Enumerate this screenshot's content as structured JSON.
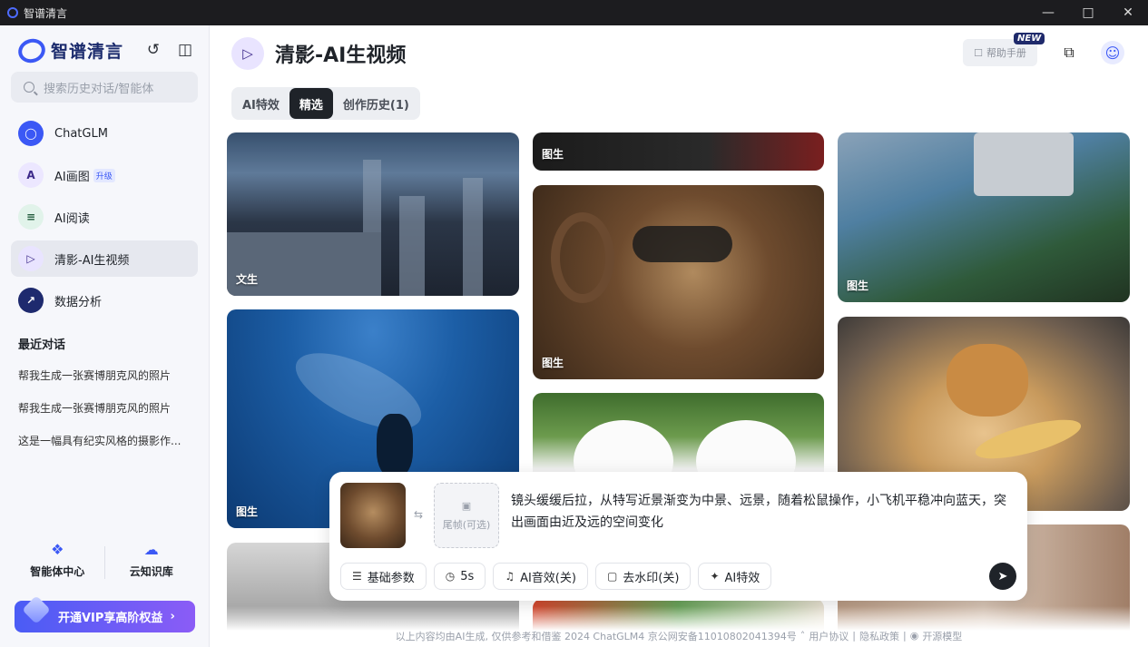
{
  "window": {
    "title": "智谱清言"
  },
  "sidebar": {
    "brand": "智谱清言",
    "search_placeholder": "搜索历史对话/智能体",
    "nav": [
      {
        "label": "ChatGLM",
        "icon": "chatglm-icon"
      },
      {
        "label": "AI画图",
        "icon": "ai-draw-icon",
        "badge": "升级"
      },
      {
        "label": "AI阅读",
        "icon": "ai-read-icon"
      },
      {
        "label": "清影-AI生视频",
        "icon": "video-play-icon"
      },
      {
        "label": "数据分析",
        "icon": "data-chart-icon"
      }
    ],
    "recent_title": "最近对话",
    "recent": [
      "帮我生成一张赛博朋克风的照片",
      "帮我生成一张赛博朋克风的照片",
      "这是一幅具有纪实风格的摄影作..."
    ],
    "bottom": [
      {
        "label": "智能体中心",
        "icon": "grid-icon"
      },
      {
        "label": "云知识库",
        "icon": "cloud-icon"
      }
    ],
    "vip_label": "开通VIP享高阶权益"
  },
  "header": {
    "title": "清影-AI生视频",
    "help_label": "帮助手册",
    "new_badge": "NEW",
    "tabs": [
      "AI特效",
      "精选",
      "创作历史(1)"
    ],
    "active_tab": 1
  },
  "gallery": {
    "labels": [
      "文生",
      "图生",
      "图生",
      "图生",
      "图生"
    ]
  },
  "composer": {
    "end_frame_label": "尾帧(可选)",
    "prompt": "镜头缓缓后拉，从特写近景渐变为中景、远景，随着松鼠操作，小飞机平稳冲向蓝天，突出画面由近及远的空间变化",
    "options": [
      {
        "label": "基础参数",
        "icon": "sliders-icon"
      },
      {
        "label": "5s",
        "icon": "clock-icon"
      },
      {
        "label": "AI音效(关)",
        "icon": "music-off-icon"
      },
      {
        "label": "去水印(关)",
        "icon": "watermark-icon"
      },
      {
        "label": "AI特效",
        "icon": "magic-icon"
      }
    ]
  },
  "footer": {
    "text": "以上内容均由AI生成, 仅供参考和借鉴   2024 ChatGLM4 京公网安备11010802041394号",
    "links": [
      "用户协议",
      "隐私政策",
      "开源模型"
    ]
  },
  "colors": {
    "accent": "#3b58f5",
    "dark": "#1f2329"
  }
}
